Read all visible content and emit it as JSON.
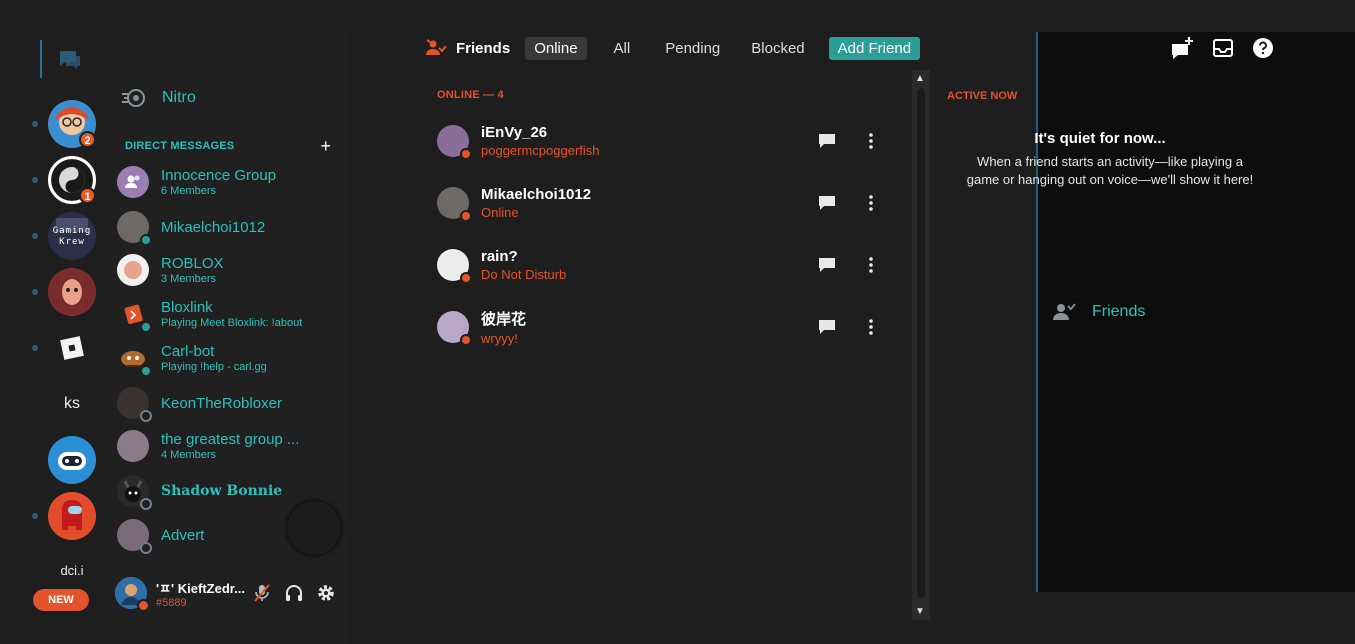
{
  "colors": {
    "accent_teal": "#2ac1bd",
    "accent_orange": "#e2542c",
    "status_online": "#2b9e98",
    "status_dnd": "#e2542c",
    "add_friend_bg": "#2b9e98"
  },
  "rail": {
    "servers": [
      {
        "kind": "avatar",
        "badge": "2",
        "color": "#d94b2b"
      },
      {
        "kind": "avatar",
        "badge": "1",
        "color": "#e8e8e8"
      },
      {
        "kind": "avatar",
        "text": "Gaming Krew",
        "color": "#3a3d55"
      },
      {
        "kind": "avatar",
        "color": "#a63a3a"
      },
      {
        "kind": "roblox-icon",
        "color": "#1e1e1e"
      }
    ],
    "ks_label": "ks",
    "dci_label": "dci.i",
    "new_label": "NEW"
  },
  "sidebar": {
    "nav": [
      {
        "label": "Friends",
        "icon": "friends-icon"
      },
      {
        "label": "Nitro",
        "icon": "nitro-icon"
      }
    ],
    "dm_header": "DIRECT MESSAGES",
    "dms": [
      {
        "name": "Innocence Group",
        "sub": "6 Members",
        "type": "group",
        "color": "#9a7fb5"
      },
      {
        "name": "Mikaelchoi1012",
        "sub": "",
        "type": "user",
        "status": "online",
        "color": "#6d6a66"
      },
      {
        "name": "ROBLOX",
        "sub": "3 Members",
        "type": "group",
        "color": "#f1f1f1"
      },
      {
        "name": "Bloxlink",
        "sub": "Playing Meet Bloxlink: !about",
        "type": "bot",
        "status": "online",
        "color": "#e2542c"
      },
      {
        "name": "Carl-bot",
        "sub": "Playing !help - carl.gg",
        "type": "bot",
        "status": "online",
        "color": "#7a5a3a"
      },
      {
        "name": "KeonTheRobloxer",
        "sub": "",
        "type": "user",
        "status": "offline",
        "color": "#3a3330"
      },
      {
        "name": "the greatest group ...",
        "sub": "4 Members",
        "type": "group",
        "color": "#8a7a8a"
      },
      {
        "name": "Shadow Bonnie",
        "sub": "",
        "type": "user",
        "status": "offline",
        "color": "#2a2a2a"
      },
      {
        "name": "Advert",
        "sub": "",
        "type": "user",
        "status": "offline",
        "color": "#7a6a7a"
      }
    ],
    "user": {
      "name": "'ㅍ' KieftZedr...",
      "tag": "#5889"
    }
  },
  "topbar": {
    "title": "Friends",
    "tabs": [
      {
        "label": "Online",
        "selected": true
      },
      {
        "label": "All",
        "selected": false
      },
      {
        "label": "Pending",
        "selected": false
      },
      {
        "label": "Blocked",
        "selected": false
      }
    ],
    "add_friend": "Add Friend"
  },
  "friends": {
    "section_label": "ONLINE — 4",
    "items": [
      {
        "name": "iEnVy_26",
        "status": "poggermcpoggerfish",
        "indicator": "online",
        "color": "#8a6e9a"
      },
      {
        "name": "Mikaelchoi1012",
        "status": "Online",
        "indicator": "online",
        "color": "#6d6a66"
      },
      {
        "name": "rain?",
        "status": "Do Not Disturb",
        "indicator": "dnd",
        "color": "#ececec"
      },
      {
        "name": "彼岸花",
        "status": "wryyy!",
        "indicator": "online",
        "color": "#b9a6c9"
      }
    ]
  },
  "active_now": {
    "title": "ACTIVE NOW",
    "heading": "It's quiet for now...",
    "body": "When a friend starts an activity—like playing a game or hanging out on voice—we'll show it here!"
  }
}
